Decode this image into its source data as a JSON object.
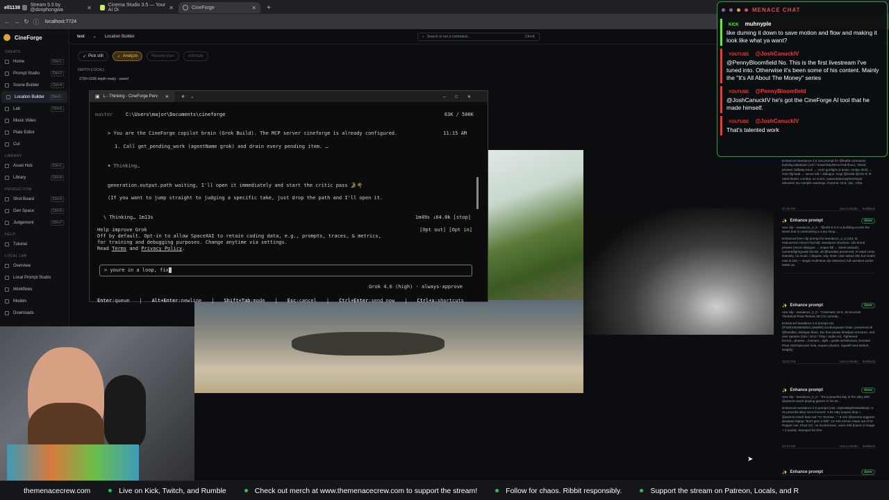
{
  "browser": {
    "tabs": [
      {
        "label": "Stream 5.5 by @donphongwa",
        "icon": "stream-icon"
      },
      {
        "label": "Cinema Studio 3.5 — Your AI Di",
        "icon": "cinema-icon"
      },
      {
        "label": "CineForge",
        "icon": "globe-icon"
      }
    ],
    "url": "localhost:7724",
    "edge_text": "ell1138"
  },
  "app": {
    "name": "CineForge",
    "project": "test",
    "page": "Location Builder",
    "search_placeholder": "Search or run a command...",
    "search_kbd": "Ctrl+K",
    "toolbar": {
      "pick": "Pick still",
      "analyze": "Analyze",
      "review": "Review plan",
      "animate": "Animate"
    },
    "left_panel": {
      "header": "DEPTH (LOCAL)",
      "sub": "2720×1536 depth ready · saved"
    },
    "sidebar": {
      "sections": [
        {
          "title": "CREATE",
          "items": [
            {
              "label": "Home",
              "kbd": "Ctrl+1"
            },
            {
              "label": "Prompt Studio",
              "kbd": "Ctrl+2"
            },
            {
              "label": "Scene Builder",
              "kbd": "Ctrl+4"
            },
            {
              "label": "Location Builder",
              "kbd": "Ctrl+5",
              "active": true
            },
            {
              "label": "Lab",
              "kbd": "Ctrl+6"
            },
            {
              "label": "Music Video",
              "kbd": ""
            },
            {
              "label": "Plate Editor",
              "kbd": ""
            },
            {
              "label": "Cut",
              "kbd": ""
            }
          ]
        },
        {
          "title": "LIBRARY",
          "items": [
            {
              "label": "Asset Hub",
              "kbd": "Ctrl+1"
            },
            {
              "label": "Library",
              "kbd": "Ctrl+8"
            }
          ]
        },
        {
          "title": "PRODUCTION",
          "items": [
            {
              "label": "Shot Board",
              "kbd": "Ctrl+9"
            },
            {
              "label": "Gen Space",
              "kbd": "Ctrl+5"
            },
            {
              "label": "Judgement",
              "kbd": "Ctrl+7"
            }
          ]
        },
        {
          "title": "HELP",
          "items": [
            {
              "label": "Tutorial",
              "kbd": ""
            }
          ]
        },
        {
          "title": "LOCAL LAB",
          "items": [
            {
              "label": "Overview",
              "kbd": ""
            },
            {
              "label": "Local Prompt Studio",
              "kbd": ""
            },
            {
              "label": "Workflows",
              "kbd": ""
            },
            {
              "label": "Models",
              "kbd": ""
            },
            {
              "label": "Downloads",
              "kbd": ""
            }
          ]
        }
      ]
    }
  },
  "terminal": {
    "tab_title": "L - Thinking - CineForge Perv",
    "cwd_branch": "master",
    "cwd_path": "C:\\Users\\major\\Documents\\cineforge",
    "context": "63K / 500K",
    "user_line": "> You are the CineForge copilot brain (Grok Build). The MCP server cineforge is already configured.",
    "time": "11:15 AM",
    "step1": "1. Call get_pending_work (agentName grok) and drain every pending item. …",
    "thinking1": "♦ Thinking…",
    "output1": "generation.output.path waiting, I'll open it immediately and start the critic pass 🐊🌴",
    "output2": "(If you want to jump straight to judging a specific take, just drop the path and I'll open it.",
    "thinking2": "\\ Thinking… 1m13s",
    "status_right": "1m49s ↓64.0k [stop]",
    "help_title": "Help improve Grok",
    "help_body1": "Off by default. Opt-in to allow SpaceXAI to retain coding data, e.g., prompts, traces, & metrics,",
    "help_body2": "for training and debugging purposes. Change anytime via settings.",
    "help_read": "Read",
    "help_terms": "Terms",
    "help_and": "and",
    "help_privacy": "Privacy Policy",
    "opt_out": "[Opt out]",
    "opt_in": "[Opt in]",
    "input_value": "> youre in a loop, fix",
    "model": "Grok 4.6 (high) · always-approve",
    "shortcuts": [
      {
        "key": "Enter",
        "desc": ":queue"
      },
      {
        "key": "Alt+Enter",
        "desc": ":newline"
      },
      {
        "key": "Shift+Tab",
        "desc": ":mode"
      },
      {
        "key": "Esc",
        "desc": ":cancel"
      },
      {
        "key": "Ctrl+Enter",
        "desc": ":send now"
      },
      {
        "key": "Ctrl+x",
        "desc": ":shortcuts"
      }
    ]
  },
  "chat": {
    "title": "MENACE CHAT",
    "messages": [
      {
        "platform": "KICK",
        "user": "muhnyple",
        "text": "like duming it down to save motion and flow and making it look like what ya want?",
        "color": "#53fc18"
      },
      {
        "platform": "YOUTUBE",
        "user": "@JoshCanuckIV",
        "text": "@PennyBloomfield No. This is the first livestream I've tuned into. Otherwise it's been some of his content. Mainly the \"It's All About The Money\" series",
        "color": "#ff3131"
      },
      {
        "platform": "YOUTUBE",
        "user": "@PennyBloomfield",
        "text": "@JoshCanuckIV he's got the CineForge AI tool that he made himself.",
        "color": "#ff3131"
      },
      {
        "platform": "YOUTUBE",
        "user": "@JoshCanuckIV",
        "text": "That's talented work",
        "color": "#ff3131"
      }
    ]
  },
  "jobs": [
    {
      "title": "Enhance prompt",
      "status": "done",
      "body": "Enhanced Seedance 2.5 15s prompt for @leafitt command-building takedown (v47 / 8Vaw7kkp3RHu7md7fnun). Timed phases: hallway track → room gunfight (4 down, empty click) → H2H flip/stab → server kill + dialogue. Kept @leafitt @ref1-9; R-rated kinetic combat; no score; camera/atmosphere/style elevated. No compile warnings. Params: 16:9, 15s, 720p.",
      "foot": "07:35 PM",
      "use": "Use in Studio",
      "fb": "feedback"
    },
    {
      "title": "Enhance prompt",
      "status": "done",
      "body": "new clip - seedance_2_5 - \"@ref3-9 is in a building across the street that is overlooking a curry shop...",
      "body2": "Enhanced free-clip prompt for seedance_2_5 (v43, id KMLwvA0z-AkranYGyFall). Seedance structure: 15s timed phases (recon dialogue → sniper kill → street assault), camera/light/grade blocks, all @handles preserved, R-rated crime intensity, no music / diegetic only. Note: user asked 30s but model max is 15s — single multi-beat clip delivered; full narrative works better as",
      "foot": "",
      "use": "",
      "fb": ""
    },
    {
      "title": "Enhance prompt",
      "status": "done",
      "body": "new clip - seedance_2_0 - \"Cinematic 16:9, 15 seconds. Theatrical Pixar-feature 3D CG comedy...",
      "body2": "Enhanced Seedance 2.0 prompt v21 (fYsZKzXbxBNr8tUCJwWkN) via Bongwater brain: preserved all @handles, dialogue lines, 15s four-phase deadpan structure, and user params (15s / 16:9 / 720p / audio on). Tightened format→phases→Camera→light→grade architecture; boosted Pixar SSS/specular look, toupee physics, squash-and-stretch, weighty",
      "foot": "19:21 PM",
      "use": "Use in Studio",
      "fb": "feedback"
    },
    {
      "title": "Enhance prompt",
      "status": "done",
      "body": "new clip - seedance_2_0 - \"It's a peaceful day in the alley with @asmon-roach playing games in his Dr...",
      "body2": "Enhanced Seedance 2.0 prompt (v19, UQ6V8BiyltO2lue9iwa): 0-4s peaceful alley micro-homes; 4-8s ratty toupee drop + @asmon-roach lean-out \"Yo Tectone...\"; 8-12s @tectone-eggman deadpan laptop \"don't give a shit\"; 12-15s Asmon steps out of Dr Pepper can. Pixar CG, no score/music, voice refs bound (2 image + 2 audio). Stamped for free-",
      "foot": "19:13 PM",
      "use": "Use in Studio",
      "fb": "feedback"
    },
    {
      "title": "Enhance prompt",
      "status": "done",
      "body": "",
      "foot": "",
      "use": "",
      "fb": ""
    }
  ],
  "ticker": [
    "themenacecrew.com",
    "Live on Kick, Twitch, and Rumble",
    "Check out merch at www.themenacecrew.com to support the stream!",
    "Follow for chaos. Ribbit responsibly.",
    "Support the stream on Patreon, Locals, and R"
  ],
  "colors": {
    "accent": "#e0a43a",
    "chat_border": "#2f9e4a",
    "kick": "#53fc18",
    "youtube": "#ff3131",
    "done": "#43c26a"
  }
}
